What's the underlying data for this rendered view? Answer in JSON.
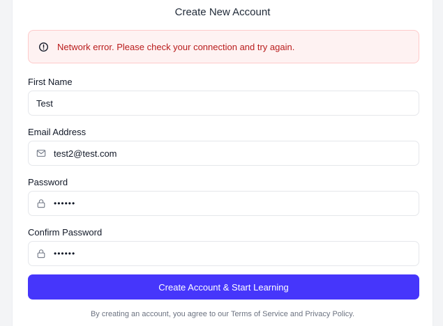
{
  "form": {
    "title": "Create New Account",
    "error": "Network error. Please check your connection and try again.",
    "first_name": {
      "label": "First Name",
      "value": "Test"
    },
    "email": {
      "label": "Email Address",
      "value": "test2@test.com"
    },
    "password": {
      "label": "Password",
      "value": "••••••"
    },
    "confirm_password": {
      "label": "Confirm Password",
      "value": "••••••"
    },
    "submit_label": "Create Account & Start Learning",
    "terms": {
      "prefix": "By creating an account, you agree to our ",
      "tos": "Terms of Service",
      "and": " and ",
      "privacy": "Privacy Policy",
      "suffix": "."
    }
  },
  "colors": {
    "primary": "#4636fb",
    "error_text": "#b91c1c",
    "error_bg": "#fef2f2",
    "error_border": "#fecaca"
  },
  "icons": {
    "alert": "alert-circle-icon",
    "email": "mail-icon",
    "password": "lock-icon"
  }
}
